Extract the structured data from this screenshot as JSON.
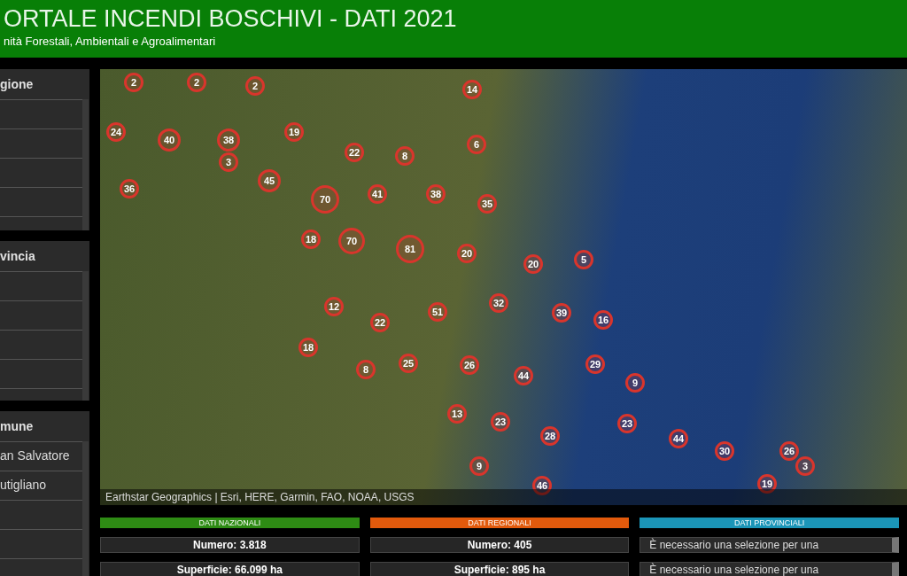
{
  "header": {
    "title": "ORTALE INCENDI BOSCHIVI - DATI 2021",
    "subtitle": "nità Forestali, Ambientali e Agroalimentari"
  },
  "filters": [
    {
      "title": "gione"
    },
    {
      "title": "vincia"
    },
    {
      "title": "mune",
      "items": [
        "an Salvatore",
        "utigliano"
      ]
    }
  ],
  "map": {
    "attribution": "Earthstar Geographics | Esri, HERE, Garmin, FAO, NOAA, USGS",
    "clusters": [
      "2",
      "2",
      "2",
      "14",
      "24",
      "40",
      "38",
      "19",
      "6",
      "22",
      "8",
      "3",
      "45",
      "36",
      "70",
      "41",
      "38",
      "35",
      "18",
      "70",
      "81",
      "20",
      "20",
      "5",
      "12",
      "32",
      "51",
      "22",
      "39",
      "16",
      "18",
      "8",
      "25",
      "26",
      "29",
      "44",
      "9",
      "13",
      "23",
      "23",
      "28",
      "44",
      "30",
      "26",
      "9",
      "3",
      "46",
      "19"
    ]
  },
  "panels": [
    {
      "kind": "national",
      "title": "DATI NAZIONALI",
      "rows": [
        "Numero: 3.818",
        "Superficie: 66.099 ha"
      ]
    },
    {
      "kind": "regional",
      "title": "DATI REGIONALI",
      "rows": [
        "Numero: 405",
        "Superficie: 895 ha"
      ]
    },
    {
      "kind": "provincial",
      "title": "DATI PROVINCIALI",
      "rows": [
        "È necessario una selezione per una",
        "È necessario una selezione per una"
      ]
    }
  ]
}
